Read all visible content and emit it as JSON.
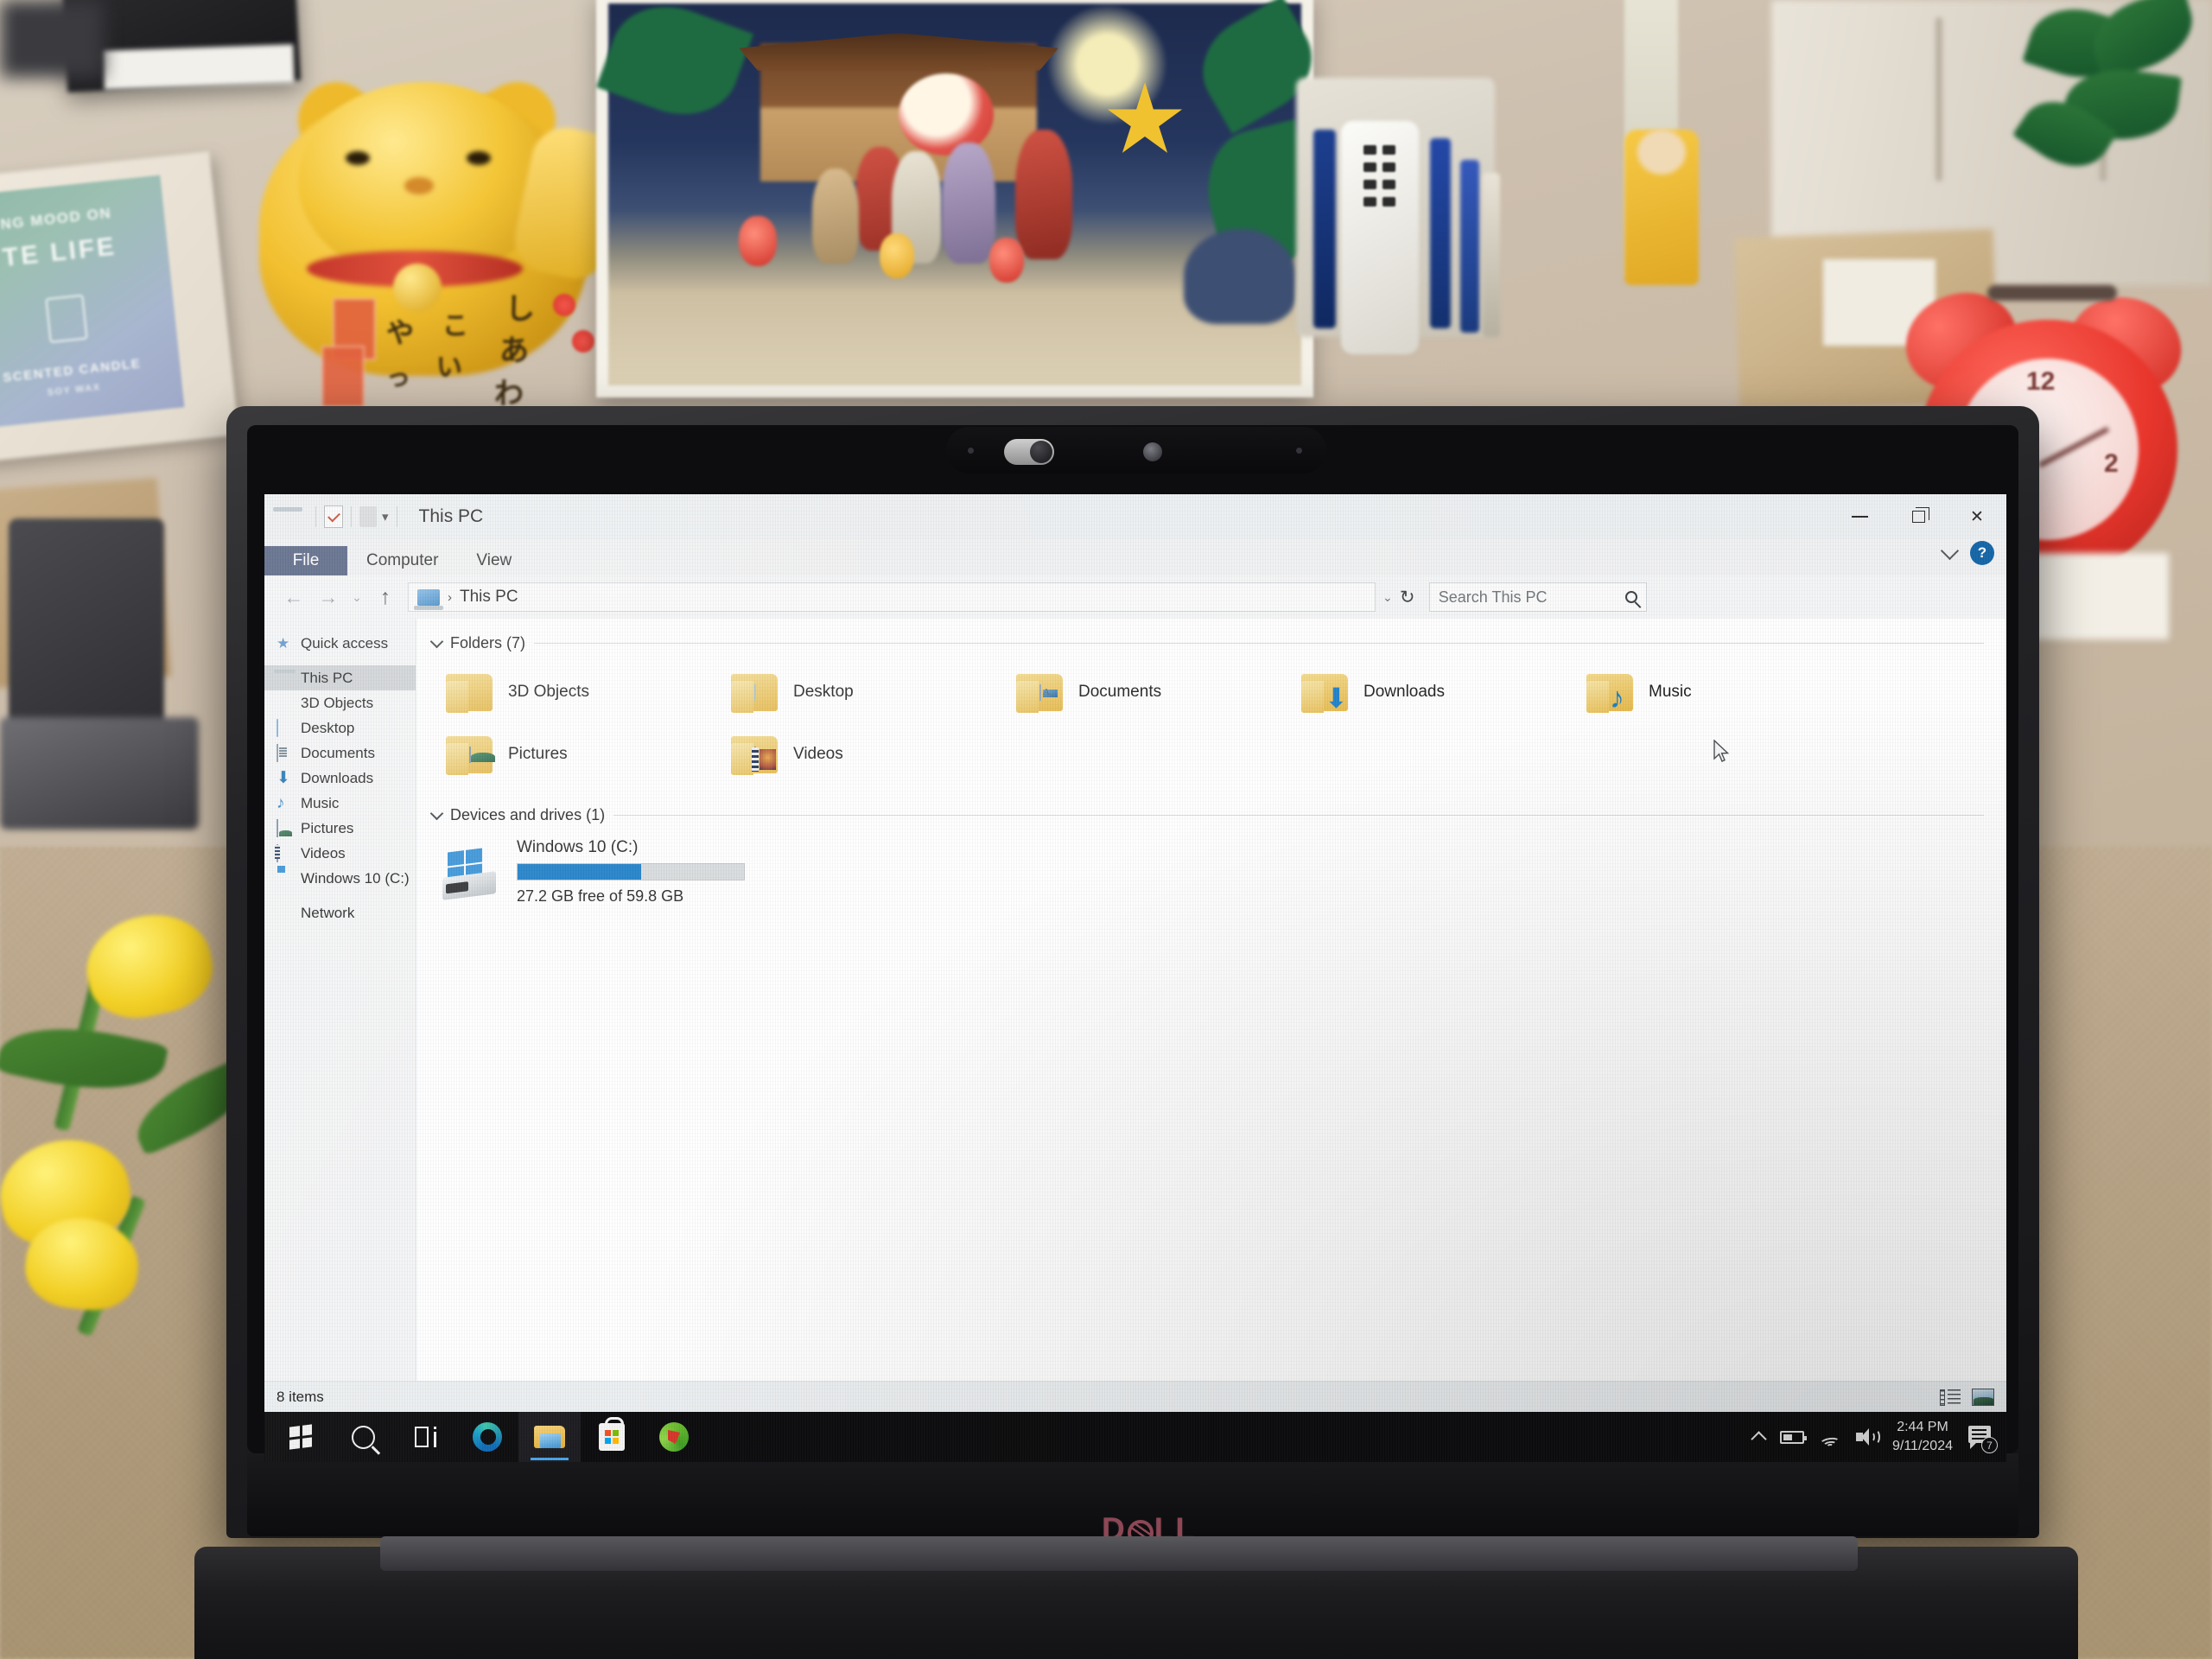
{
  "scene": {
    "device_brand": "DELL",
    "desk_objects": [
      {
        "name": "scented-candle-box",
        "line1": "NG MOOD ON",
        "line2": "TE LIFE",
        "line3": "SCENTED CANDLE",
        "line4": "SOY WAX"
      },
      {
        "name": "maneki-neko-cat",
        "jp1": "し",
        "jp2": "あ",
        "jp3": "わ",
        "jp4": "こ",
        "jp5": "い",
        "jp6": "や",
        "jp7": "っ"
      },
      {
        "name": "framed-artwork"
      },
      {
        "name": "pen-holder"
      },
      {
        "name": "red-alarm-clock",
        "num12": "12",
        "num2": "2"
      },
      {
        "name": "yellow-tulips"
      },
      {
        "name": "potted-plant"
      },
      {
        "name": "bluetooth-speaker"
      }
    ]
  },
  "window": {
    "title": "This PC",
    "quick_access": [
      "this-pc-icon",
      "properties-icon",
      "new-folder-icon",
      "customize-caret"
    ],
    "controls": {
      "minimize": "—",
      "maximize": "❐",
      "close": "✕"
    }
  },
  "ribbon": {
    "tabs": [
      {
        "label": "File",
        "active": true
      },
      {
        "label": "Computer",
        "active": false
      },
      {
        "label": "View",
        "active": false
      }
    ],
    "expand_icon": "chevron-down-icon",
    "help_label": "?"
  },
  "address": {
    "back": "←",
    "forward": "→",
    "recent": "⌄",
    "up": "↑",
    "crumb_icon": "this-pc-icon",
    "crumb_sep": "›",
    "crumb_text": "This PC",
    "dropdown": "⌄",
    "refresh": "↻"
  },
  "search": {
    "placeholder": "Search This PC",
    "icon": "search-icon"
  },
  "sidebar": {
    "items": [
      {
        "label": "Quick access",
        "icon": "star-icon",
        "selected": false
      },
      {
        "label": "This PC",
        "icon": "this-pc-icon",
        "selected": true
      },
      {
        "label": "3D Objects",
        "icon": "3d-objects-icon",
        "selected": false
      },
      {
        "label": "Desktop",
        "icon": "desktop-icon",
        "selected": false
      },
      {
        "label": "Documents",
        "icon": "documents-icon",
        "selected": false
      },
      {
        "label": "Downloads",
        "icon": "downloads-icon",
        "selected": false
      },
      {
        "label": "Music",
        "icon": "music-icon",
        "selected": false
      },
      {
        "label": "Pictures",
        "icon": "pictures-icon",
        "selected": false
      },
      {
        "label": "Videos",
        "icon": "videos-icon",
        "selected": false
      },
      {
        "label": "Windows 10 (C:)",
        "icon": "drive-icon",
        "selected": false
      },
      {
        "label": "Network",
        "icon": "network-icon",
        "selected": false
      }
    ]
  },
  "content": {
    "folders_group": {
      "title": "Folders (7)",
      "chevron": "chevron-expanded-icon",
      "items": [
        {
          "label": "3D Objects",
          "icon": "folder-3d-objects"
        },
        {
          "label": "Desktop",
          "icon": "folder-desktop"
        },
        {
          "label": "Documents",
          "icon": "folder-documents"
        },
        {
          "label": "Downloads",
          "icon": "folder-downloads"
        },
        {
          "label": "Music",
          "icon": "folder-music"
        },
        {
          "label": "Pictures",
          "icon": "folder-pictures"
        },
        {
          "label": "Videos",
          "icon": "folder-videos"
        }
      ]
    },
    "drives_group": {
      "title": "Devices and drives (1)",
      "chevron": "chevron-expanded-icon",
      "drive": {
        "name": "Windows 10 (C:)",
        "capacity_text": "27.2 GB free of 59.8 GB",
        "used_percent": 54.5,
        "bar_color": "#1279c6",
        "icon": "windows-drive-icon"
      }
    }
  },
  "statusbar": {
    "item_count": "8 items",
    "view_buttons": [
      {
        "name": "details-view-button",
        "icon": "details-view-icon"
      },
      {
        "name": "large-icons-view-button",
        "icon": "large-icons-view-icon"
      }
    ]
  },
  "taskbar": {
    "items": [
      {
        "name": "start-button",
        "icon": "windows-logo-icon",
        "active": false
      },
      {
        "name": "search-button",
        "icon": "search-icon",
        "active": false
      },
      {
        "name": "task-view-button",
        "icon": "task-view-icon",
        "active": false
      },
      {
        "name": "edge-button",
        "icon": "edge-icon",
        "active": false
      },
      {
        "name": "file-explorer-button",
        "icon": "file-explorer-icon",
        "active": true
      },
      {
        "name": "microsoft-store-button",
        "icon": "store-icon",
        "active": false
      },
      {
        "name": "green-app-button",
        "icon": "green-app-icon",
        "active": false
      }
    ],
    "tray": {
      "overflow": "chevron-up-icon",
      "battery": "battery-icon",
      "wifi": "wifi-icon",
      "volume": "volume-icon",
      "time": "2:44 PM",
      "date": "9/11/2024",
      "notification_icon": "action-center-icon",
      "notification_count": "7"
    }
  },
  "colors": {
    "accent": "#1279c6",
    "ribbon_file": "#4d5b7c",
    "taskbar": "#0b0b0d",
    "selection": "#cdd1d4",
    "dell_logo": "#8d4755"
  }
}
